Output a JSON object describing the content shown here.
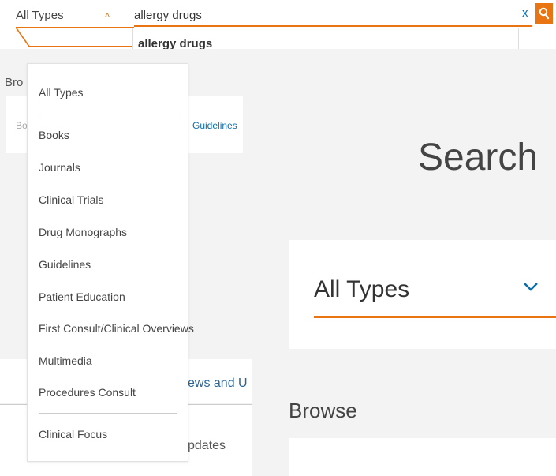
{
  "search": {
    "type_label": "All Types",
    "query": "allergy drugs",
    "clear_label": "x",
    "suggestion": "allergy drugs"
  },
  "dropdown": {
    "items": [
      "All Types",
      "Books",
      "Journals",
      "Clinical Trials",
      "Drug Monographs",
      "Guidelines",
      "Patient Education",
      "First Consult/Clinical Overviews",
      "Multimedia",
      "Procedures Consult",
      "Clinical Focus"
    ]
  },
  "background": {
    "browse_left": "Bro",
    "card_left_text": "Bo",
    "card_guidelines": "Guidelines",
    "news_partial": "ews and U",
    "updates_partial": "pdates",
    "search_heading": "Search",
    "type_select_label": "All Types",
    "browse_heading": "Browse"
  },
  "colors": {
    "accent": "#e87511",
    "link": "#0a6ea8"
  },
  "icons": {
    "type_chevron": "chevron-up-icon",
    "search_button": "search-icon",
    "big_chevron": "chevron-down-icon"
  }
}
